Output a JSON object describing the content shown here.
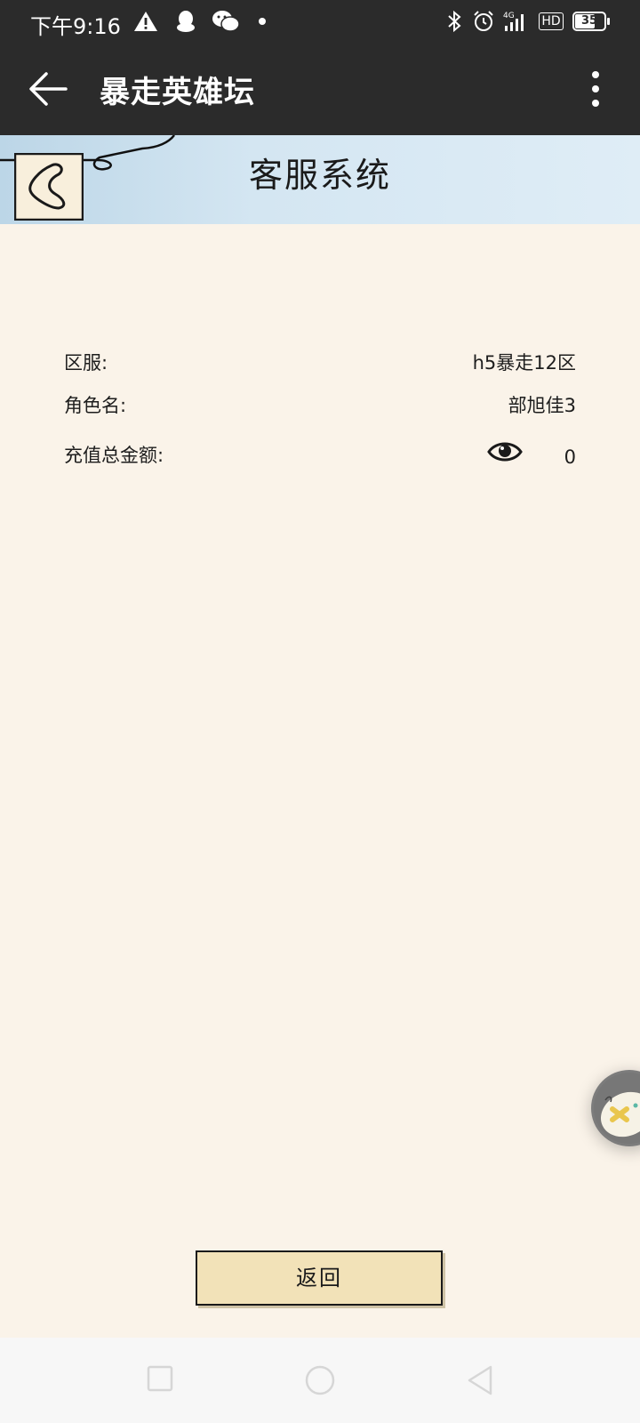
{
  "status_bar": {
    "time": "下午9:16",
    "network": "4G",
    "hd": "HD",
    "battery": "35"
  },
  "app_bar": {
    "title": "暴走英雄坛"
  },
  "page": {
    "heading": "客服系统",
    "rows": [
      {
        "label": "区服:",
        "value": "h5暴走12区"
      },
      {
        "label": "角色名:",
        "value": "部旭佳3"
      },
      {
        "label": "充值总金额:",
        "value": "0"
      }
    ],
    "return_button": "返回"
  },
  "colors": {
    "page_bg": "#faf3e9",
    "bar_bg": "#2b2b2b",
    "header_blue": "#d4e6f2",
    "button_bg": "#f2e2b8"
  }
}
